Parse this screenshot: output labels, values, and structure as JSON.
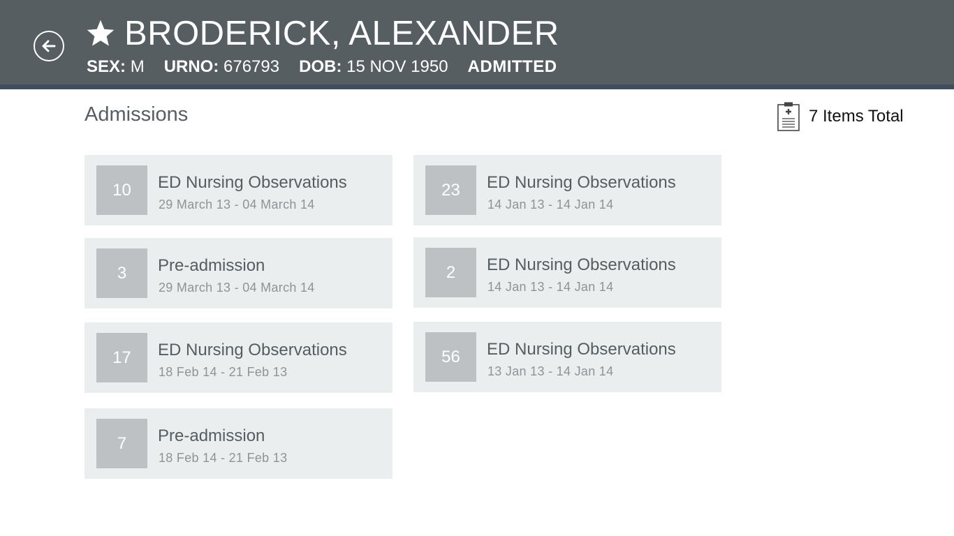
{
  "header": {
    "patient_name": "BRODERICK, ALEXANDER",
    "sex_label": "SEX:",
    "sex_value": "M",
    "urno_label": "URNO:",
    "urno_value": "676793",
    "dob_label": "DOB:",
    "dob_value": "15 NOV 1950",
    "status": "ADMITTED",
    "icons": {
      "back": "back-arrow-circle-icon",
      "favorite": "star-icon"
    },
    "colors": {
      "bar": "#575e62",
      "strip": "#3f4d5c"
    }
  },
  "page": {
    "title": "Admissions",
    "total_label": "7 Items Total",
    "total_icon": "clipboard-icon"
  },
  "admissions": [
    {
      "count": "10",
      "title": "ED Nursing Observations",
      "dates": "29 March 13 - 04 March 14"
    },
    {
      "count": "23",
      "title": "ED Nursing Observations",
      "dates": "14 Jan 13 - 14 Jan 14"
    },
    {
      "count": "3",
      "title": "Pre-admission",
      "dates": "29 March 13 - 04 March 14"
    },
    {
      "count": "2",
      "title": "ED Nursing Observations",
      "dates": "14 Jan 13 - 14 Jan 14"
    },
    {
      "count": "17",
      "title": "ED Nursing Observations",
      "dates": "18 Feb 14 - 21 Feb 13"
    },
    {
      "count": "56",
      "title": "ED Nursing Observations",
      "dates": "13 Jan 13 - 14 Jan 14"
    },
    {
      "count": "7",
      "title": "Pre-admission",
      "dates": "18 Feb 14 - 21 Feb 13"
    }
  ],
  "colors": {
    "tile_bg": "#ebeeef",
    "count_bg": "#bdc1c4"
  }
}
